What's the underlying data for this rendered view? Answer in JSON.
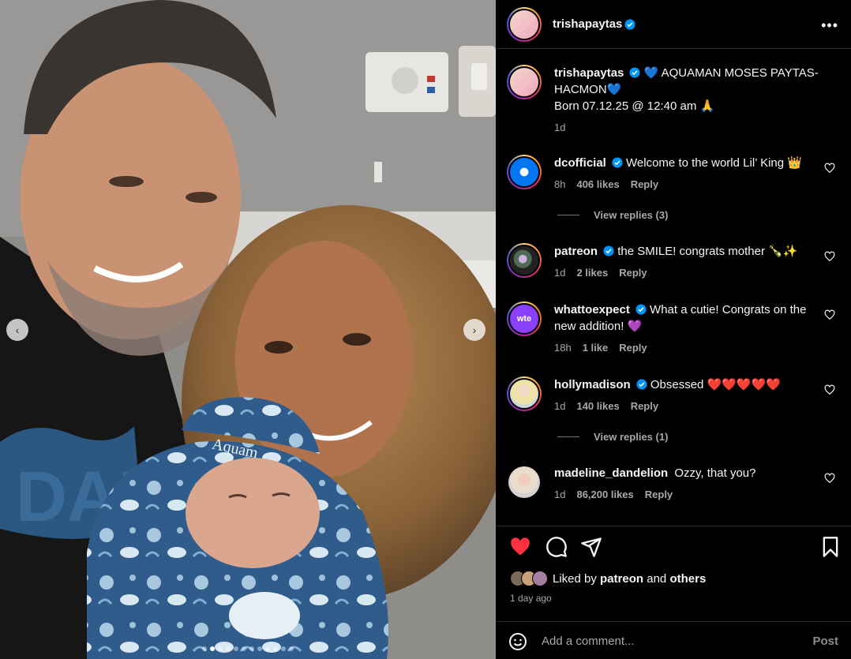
{
  "post": {
    "author": "trishapaytas",
    "verified_icon": "verified-badge-icon",
    "more_icon": "more-options-icon",
    "more_label": "•••",
    "nav_prev": "‹",
    "nav_next": "›",
    "slide_count": 12,
    "active_slide": 2
  },
  "caption": {
    "username": "trishapaytas",
    "line1": "💙 AQUAMAN MOSES PAYTAS-HACMON💙",
    "line2": "Born 07.12.25 @ 12:40 am 🙏",
    "time": "1d"
  },
  "comments": [
    {
      "username": "dcofficial",
      "text": "Welcome to the world Lil’ King 👑",
      "time": "8h",
      "likes": "406 likes",
      "reply": "Reply",
      "view_replies": "View replies (3)"
    },
    {
      "username": "patreon",
      "text": "the SMILE! congrats mother 🍾✨",
      "time": "1d",
      "likes": "2 likes",
      "reply": "Reply"
    },
    {
      "username": "whattoexpect",
      "text": "What a cutie! Congrats on the new addition! 💜",
      "time": "18h",
      "likes": "1 like",
      "reply": "Reply",
      "avatar_text": "wte"
    },
    {
      "username": "hollymadison",
      "text": "Obsessed ❤️❤️❤️❤️❤️",
      "time": "1d",
      "likes": "140 likes",
      "reply": "Reply",
      "view_replies": "View replies (1)"
    },
    {
      "username": "madeline_dandelion",
      "text": "Ozzy, that you?",
      "time": "1d",
      "likes": "86,200 likes",
      "reply": "Reply"
    }
  ],
  "actions": {
    "like_icon": "heart-filled-icon",
    "comment_icon": "comment-icon",
    "share_icon": "share-icon",
    "save_icon": "bookmark-icon",
    "liked_by_prefix": "Liked by",
    "liked_by_user": "patreon",
    "liked_by_and": "and",
    "liked_by_others": "others",
    "posted_ago": "1 day ago"
  },
  "composer": {
    "emoji_icon": "emoji-icon",
    "placeholder": "Add a comment...",
    "post_label": "Post"
  },
  "colors": {
    "background": "#000000",
    "like_red": "#ff3040",
    "verified_blue": "#0095f6",
    "muted_text": "#a8a8a8"
  }
}
